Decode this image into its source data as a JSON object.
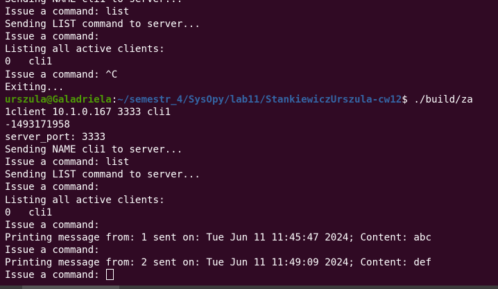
{
  "terminal": {
    "lines": [
      "Sending NAME cli1 to server...",
      "Issue a command: list",
      "Sending LIST command to server...",
      "Issue a command:",
      "Listing all active clients:",
      "0   cli1",
      "Issue a command: ^C",
      "Exiting..."
    ],
    "prompt": {
      "user_host": "urszula@Galadriela",
      "colon": ":",
      "path": "~/semestr_4/SysOpy/lab11/StankiewiczUrszula-cw12",
      "command": "$ ./build/za"
    },
    "lines_after": [
      "1client 10.1.0.167 3333 cli1",
      "-1493171958",
      "server_port: 3333",
      "Sending NAME cli1 to server...",
      "Issue a command: list",
      "Sending LIST command to server...",
      "Issue a command:",
      "Listing all active clients:",
      "0   cli1",
      "Issue a command:",
      "Printing message from: 1 sent on: Tue Jun 11 11:45:47 2024; Content: abc",
      "Issue a command:",
      "Printing message from: 2 sent on: Tue Jun 11 11:49:09 2024; Content: def"
    ],
    "current_prompt": "Issue a command: "
  },
  "colors": {
    "background": "#300a24",
    "text": "#ffffff",
    "user_host": "#4e9a06",
    "path": "#3465a4"
  }
}
